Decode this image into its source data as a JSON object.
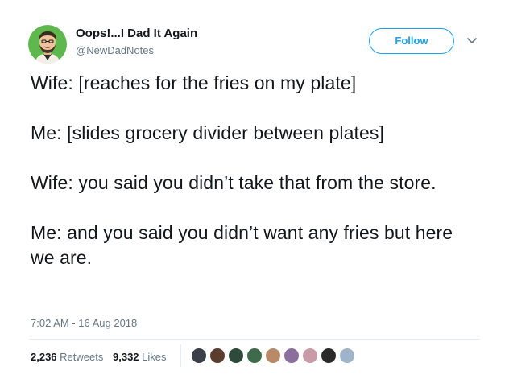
{
  "author": {
    "display_name": "Oops!...I Dad It Again",
    "handle": "@NewDadNotes",
    "avatar_icon": "cartoon-face-avatar"
  },
  "follow_button": {
    "label": "Follow"
  },
  "menu": {
    "icon": "chevron-down-icon"
  },
  "tweet": {
    "paragraphs": [
      "Wife: [reaches for the fries on my plate]",
      "Me: [slides grocery divider between plates]",
      "Wife: you said you didn’t take that from the store.",
      "Me: and you said you didn’t want any fries but here we are."
    ],
    "timestamp": "7:02 AM - 16 Aug 2018"
  },
  "stats": {
    "retweets_count": "2,236",
    "retweets_label": "Retweets",
    "likes_count": "9,332",
    "likes_label": "Likes"
  },
  "colors": {
    "brand": "#1da1f2",
    "text": "#14171a",
    "secondary_text": "#657786",
    "divider": "#e6ecf0",
    "avatar_bg": "#5fb84e"
  },
  "liker_avatars": [
    {
      "color": "#3b3f4a"
    },
    {
      "color": "#5a3d2f"
    },
    {
      "color": "#2e4a3a"
    },
    {
      "color": "#3f6b4d"
    },
    {
      "color": "#b88a6a"
    },
    {
      "color": "#8a6e9e"
    },
    {
      "color": "#c99aa8"
    },
    {
      "color": "#2a2a2a"
    },
    {
      "color": "#9fb4c8"
    }
  ]
}
